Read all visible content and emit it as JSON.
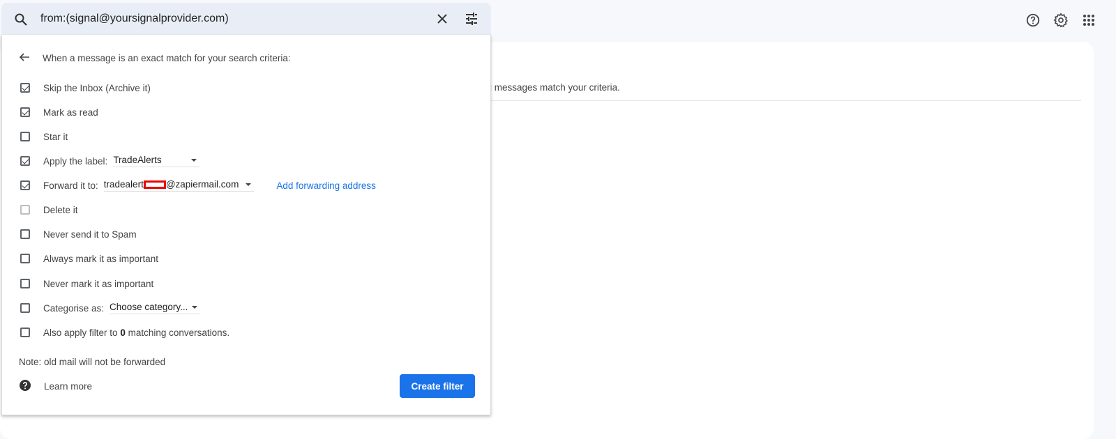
{
  "search": {
    "value": "from:(signal@yoursignalprovider.com)"
  },
  "results": {
    "message": "ng messages match your criteria."
  },
  "filter": {
    "header": "When a message is an exact match for your search criteria:",
    "options": [
      {
        "label": "Skip the Inbox (Archive it)",
        "checked": true
      },
      {
        "label": "Mark as read",
        "checked": true
      },
      {
        "label": "Star it",
        "checked": false
      },
      {
        "label": "Apply the label:",
        "checked": true,
        "select": "TradeAlerts"
      },
      {
        "label": "Forward it to:",
        "checked": true,
        "select_prefix": "tradealert",
        "select_suffix": "@zapiermail.com",
        "link": "Add forwarding address"
      },
      {
        "label": "Delete it",
        "checked": false,
        "disabled": true
      },
      {
        "label": "Never send it to Spam",
        "checked": false
      },
      {
        "label": "Always mark it as important",
        "checked": false
      },
      {
        "label": "Never mark it as important",
        "checked": false
      },
      {
        "label": "Categorise as:",
        "checked": false,
        "select": "Choose category..."
      },
      {
        "label_pre": "Also apply filter to ",
        "count": "0",
        "label_post": " matching conversations.",
        "checked": false
      }
    ],
    "note": "Note: old mail will not be forwarded",
    "learn_more": "Learn more",
    "create": "Create filter"
  },
  "colors": {
    "accent": "#1a73e8",
    "background": "#f6f8fc",
    "search_bg": "#e9eef6",
    "redaction": "#ee0000"
  }
}
